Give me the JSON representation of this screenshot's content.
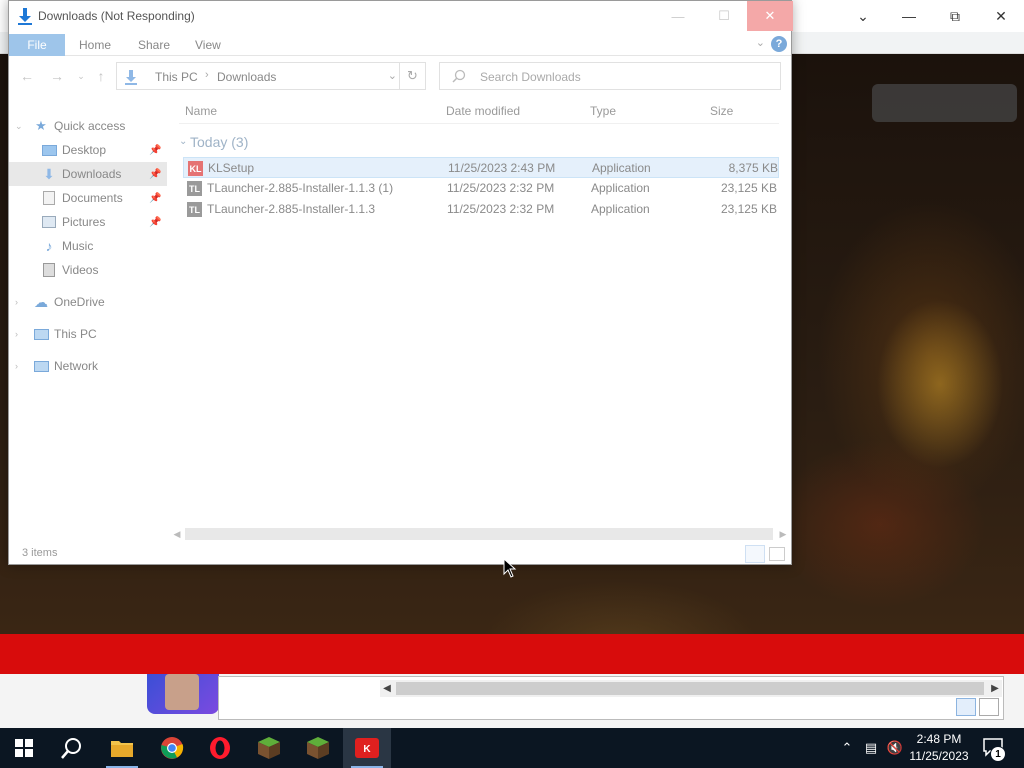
{
  "explorer": {
    "title": "Downloads (Not Responding)",
    "ribbon_tabs": [
      "File",
      "Home",
      "Share",
      "View"
    ],
    "breadcrumb": [
      "This PC",
      "Downloads"
    ],
    "search_placeholder": "Search Downloads",
    "nav": {
      "quick_access": "Quick access",
      "items": [
        "Desktop",
        "Downloads",
        "Documents",
        "Pictures",
        "Music",
        "Videos"
      ],
      "selected": "Downloads",
      "onedrive": "OneDrive",
      "this_pc": "This PC",
      "network": "Network"
    },
    "columns": {
      "name": "Name",
      "date": "Date modified",
      "type": "Type",
      "size": "Size"
    },
    "group": "Today (3)",
    "files": [
      {
        "icon": "KL",
        "name": "KLSetup",
        "date": "11/25/2023 2:43 PM",
        "type": "Application",
        "size": "8,375 KB"
      },
      {
        "icon": "TL",
        "name": "TLauncher-2.885-Installer-1.1.3 (1)",
        "date": "11/25/2023 2:32 PM",
        "type": "Application",
        "size": "23,125 KB"
      },
      {
        "icon": "TL",
        "name": "TLauncher-2.885-Installer-1.1.3",
        "date": "11/25/2023 2:32 PM",
        "type": "Application",
        "size": "23,125 KB"
      }
    ],
    "status": "3 items"
  },
  "taskbar": {
    "time": "2:48 PM",
    "date": "11/25/2023",
    "notifications": "1",
    "apps": [
      "file-explorer",
      "chrome",
      "opera",
      "minecraft",
      "minecraft",
      "kaspersky"
    ]
  },
  "colors": {
    "accent": "#0078d7",
    "file_tab": "#9ec5ea",
    "taskbar": "#0b1622",
    "banner_red": "#d80c0c",
    "selection": "#e5f0fb"
  }
}
